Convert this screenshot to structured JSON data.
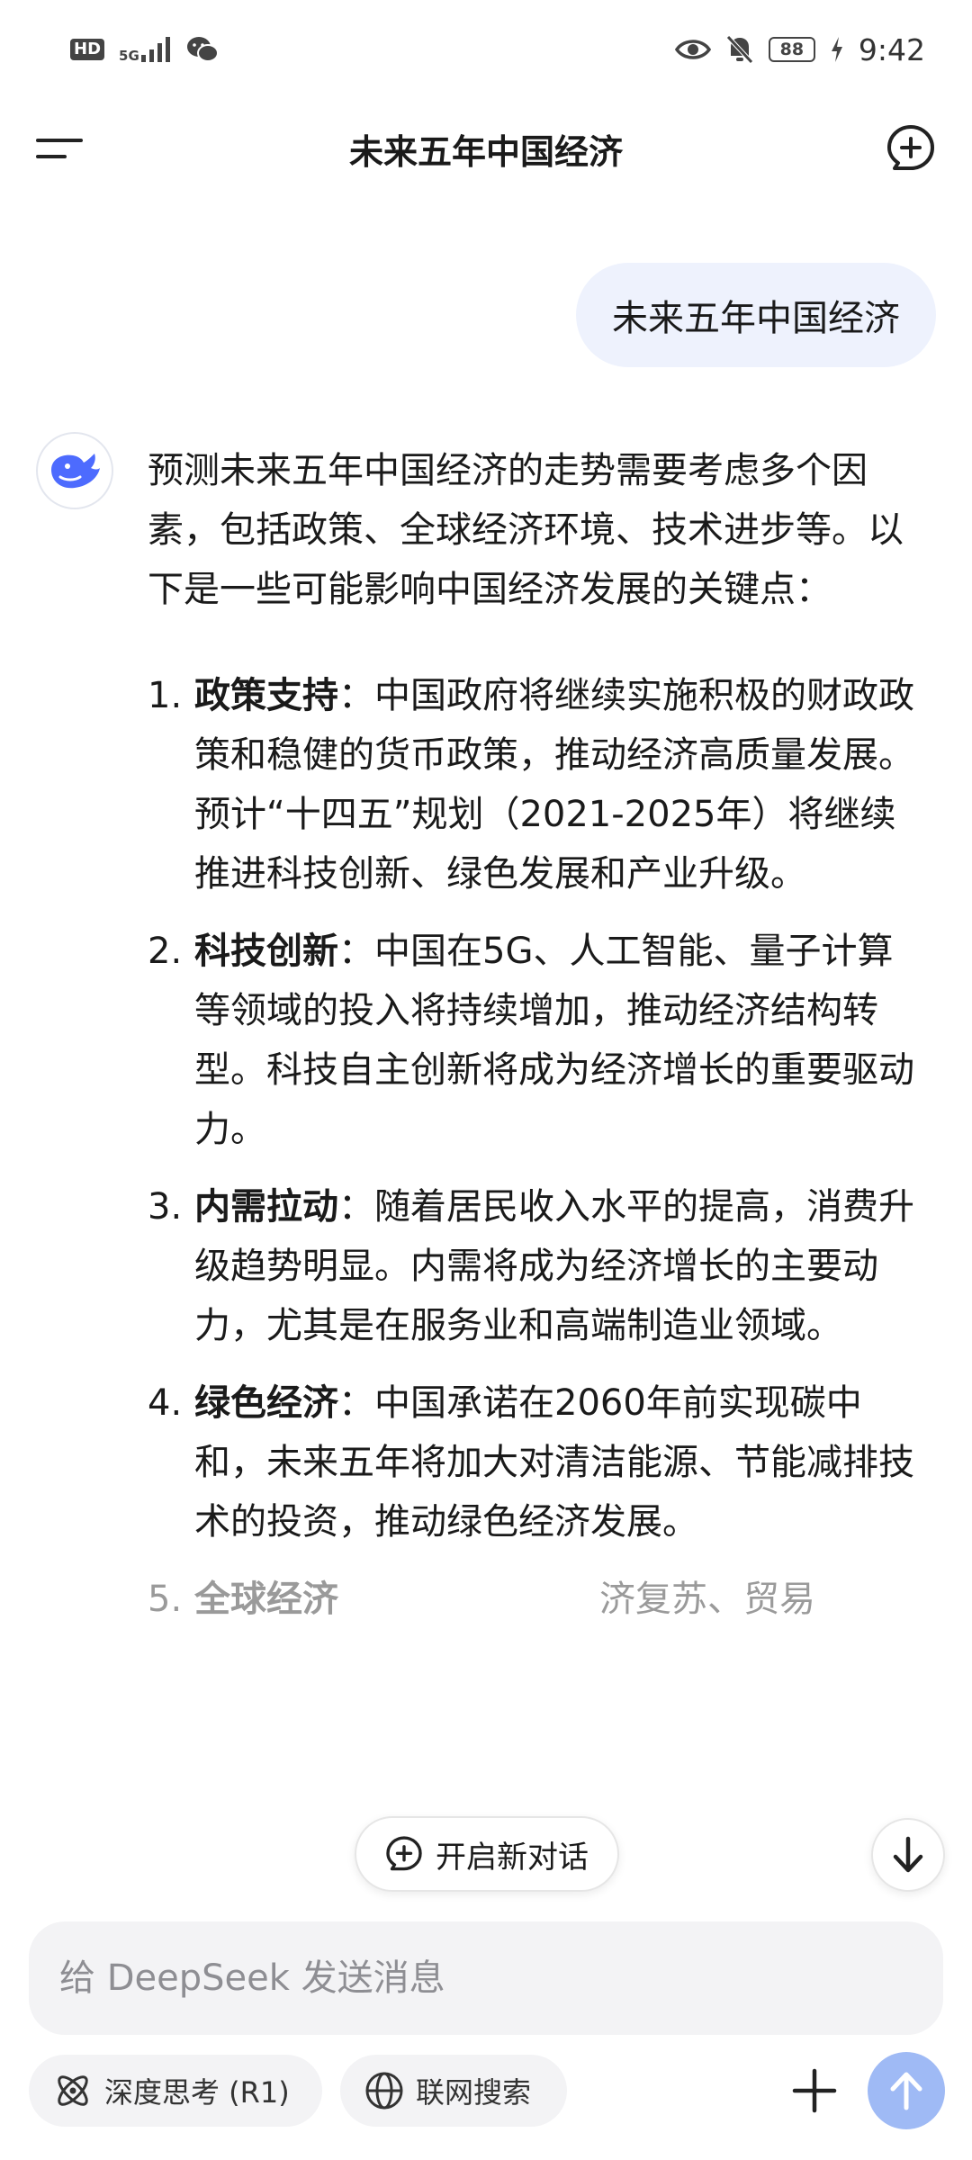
{
  "status_bar": {
    "hd": "HD",
    "network": "5G",
    "battery": "88",
    "time": "9:42",
    "icons": [
      "hd-icon",
      "5g-signal-icon",
      "wechat-icon",
      "eye-icon",
      "bell-off-icon",
      "battery-icon",
      "charging-icon"
    ]
  },
  "header": {
    "title": "未来五年中国经济",
    "menu_icon": "menu-icon",
    "new_chat_icon": "chat-plus-icon"
  },
  "user_message": "未来五年中国经济",
  "assistant": {
    "avatar_icon": "deepseek-whale-icon",
    "intro": "预测未来五年中国经济的走势需要考虑多个因素，包括政策、全球经济环境、技术进步等。以下是一些可能影响中国经济发展的关键点：",
    "points": [
      {
        "num": "1.",
        "title": "政策支持",
        "sep": "：",
        "text": "中国政府将继续实施积极的财政政策和稳健的货币政策，推动经济高质量发展。预计“十四五”规划（2021-2025年）将继续推进科技创新、绿色发展和产业升级。"
      },
      {
        "num": "2.",
        "title": "科技创新",
        "sep": "：",
        "text": "中国在5G、人工智能、量子计算等领域的投入将持续增加，推动经济结构转型。科技自主创新将成为经济增长的重要驱动力。"
      },
      {
        "num": "3.",
        "title": "内需拉动",
        "sep": "：",
        "text": "随着居民收入水平的提高，消费升级趋势明显。内需将成为经济增长的主要动力，尤其是在服务业和高端制造业领域。"
      },
      {
        "num": "4.",
        "title": "绿色经济",
        "sep": "：",
        "text": "中国承诺在2060年前实现碳中和，未来五年将加大对清洁能源、节能减排技术的投资，推动绿色经济发展。"
      },
      {
        "num": "5.",
        "title": "全球经济",
        "sep": "",
        "text": "济复苏、贸易"
      }
    ]
  },
  "floating": {
    "new_chat_label": "开启新对话",
    "new_chat_icon": "chat-plus-icon",
    "scroll_icon": "arrow-down-icon"
  },
  "composer": {
    "placeholder": "给 DeepSeek 发送消息",
    "value": "",
    "deep_think_label": "深度思考 (R1)",
    "deep_think_icon": "atom-icon",
    "web_search_label": "联网搜索",
    "web_search_icon": "globe-icon",
    "attach_icon": "plus-icon",
    "send_icon": "arrow-up-icon"
  },
  "colors": {
    "accent": "#4d6bfe",
    "user_bubble": "#eef2fd",
    "send_button": "#9fbaf5",
    "chip_bg": "#f3f3f5"
  }
}
